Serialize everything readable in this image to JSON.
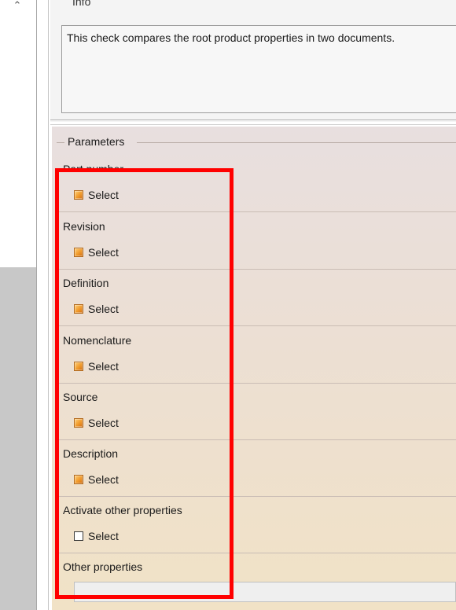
{
  "info": {
    "title": "Info",
    "text": "This check compares the root product properties in two documents."
  },
  "parameters": {
    "legend": "Parameters",
    "rows": [
      {
        "label": "Part number",
        "select_label": "Select",
        "checked": true
      },
      {
        "label": "Revision",
        "select_label": "Select",
        "checked": true
      },
      {
        "label": "Definition",
        "select_label": "Select",
        "checked": true
      },
      {
        "label": "Nomenclature",
        "select_label": "Select",
        "checked": true
      },
      {
        "label": "Source",
        "select_label": "Select",
        "checked": true
      },
      {
        "label": "Description",
        "select_label": "Select",
        "checked": true
      },
      {
        "label": "Activate other properties",
        "select_label": "Select",
        "checked": false
      }
    ],
    "other_properties": {
      "label": "Other properties",
      "value": ""
    }
  },
  "colors": {
    "highlight": "#ff0000",
    "checkbox_checked": "#f09a2c"
  },
  "icons": {
    "scroll_up": "chevron-up-icon"
  }
}
